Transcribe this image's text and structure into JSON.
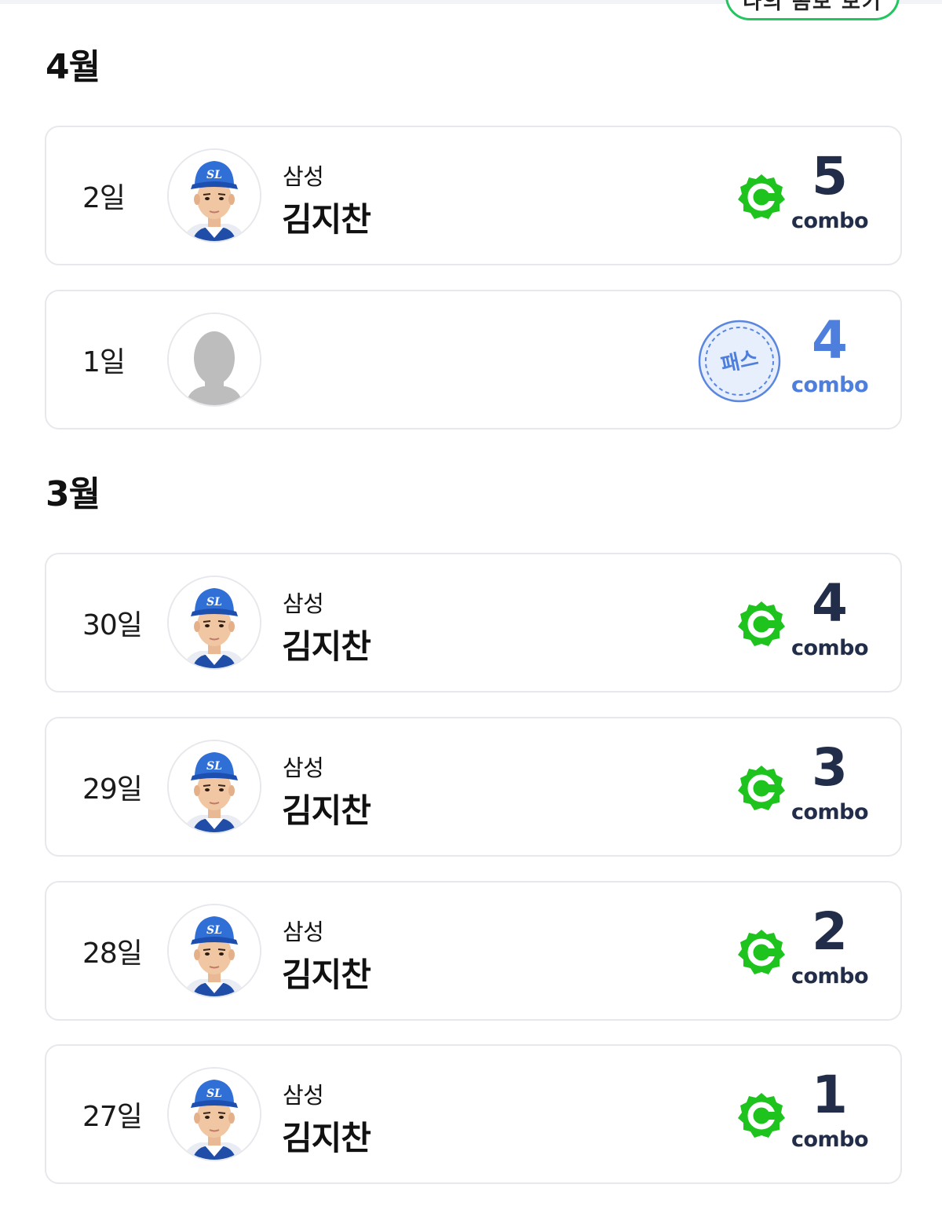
{
  "header": {
    "top_button_label": "나의 콤보 보기"
  },
  "sections": [
    {
      "month": "4월",
      "entries": [
        {
          "day": "2일",
          "team": "삼성",
          "player": "김지찬",
          "type": "hit",
          "combo": "5",
          "combo_label": "combo"
        },
        {
          "day": "1일",
          "team": "",
          "player": "",
          "type": "pass",
          "pass_label": "패스",
          "combo": "4",
          "combo_label": "combo"
        }
      ]
    },
    {
      "month": "3월",
      "entries": [
        {
          "day": "30일",
          "team": "삼성",
          "player": "김지찬",
          "type": "hit",
          "combo": "4",
          "combo_label": "combo"
        },
        {
          "day": "29일",
          "team": "삼성",
          "player": "김지찬",
          "type": "hit",
          "combo": "3",
          "combo_label": "combo"
        },
        {
          "day": "28일",
          "team": "삼성",
          "player": "김지찬",
          "type": "hit",
          "combo": "2",
          "combo_label": "combo"
        },
        {
          "day": "27일",
          "team": "삼성",
          "player": "김지찬",
          "type": "hit",
          "combo": "1",
          "combo_label": "combo"
        }
      ]
    }
  ],
  "colors": {
    "accent_green": "#22c55e",
    "badge_green": "#1ec31e",
    "combo_dark": "#222d4a",
    "pass_blue": "#4f7fdc"
  },
  "icons": {
    "hit_badge": "green-c-badge-icon",
    "pass_badge": "pass-stamp-icon",
    "player_photo": "player-avatar",
    "empty_photo": "silhouette-avatar"
  }
}
